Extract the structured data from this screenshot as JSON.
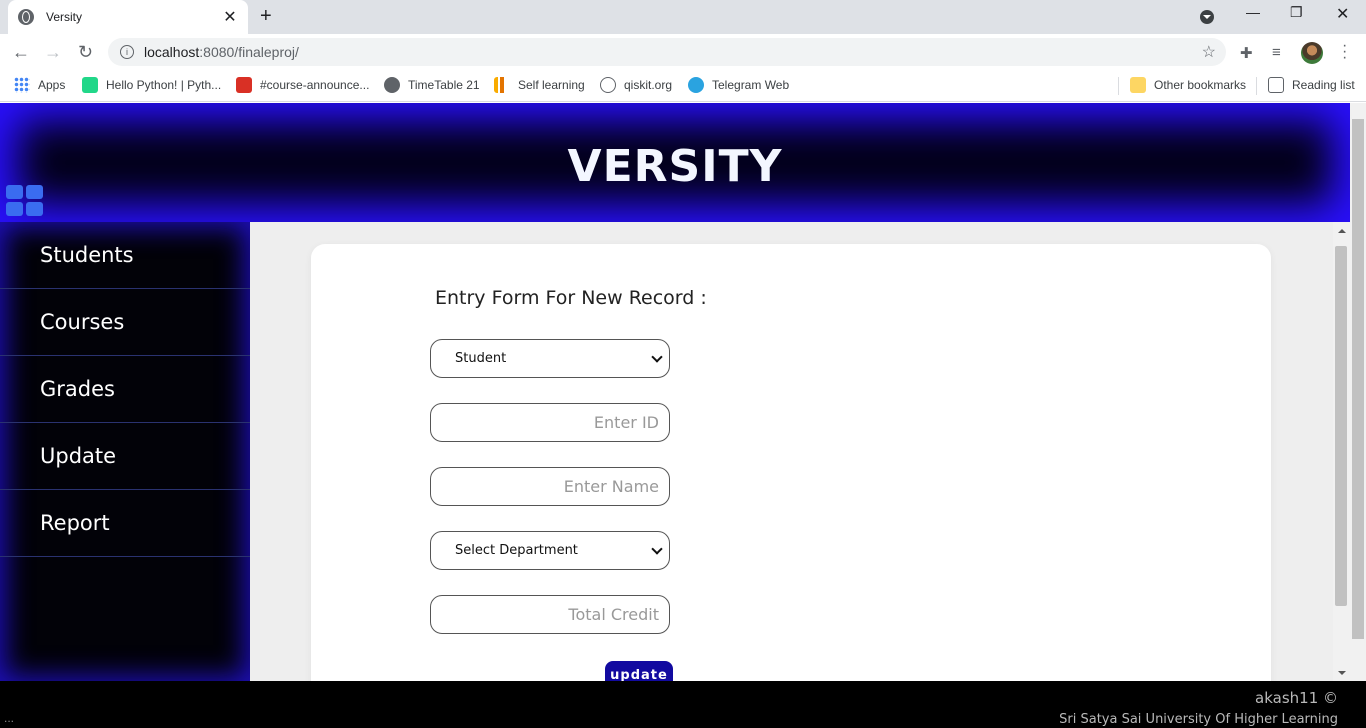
{
  "browser": {
    "tab_title": "Versity",
    "tab_close": "✕",
    "new_tab": "+",
    "url_host": "localhost",
    "url_path": ":8080/finaleproj/",
    "bookmarks": [
      {
        "label": "Apps",
        "color": "#ea4335"
      },
      {
        "label": "Hello Python! | Pyth...",
        "color": "#21d789"
      },
      {
        "label": "#course-announce...",
        "color": "#d93025"
      },
      {
        "label": "TimeTable 21",
        "color": "#5f6368"
      },
      {
        "label": "Self learning",
        "color": "#f9ab00"
      },
      {
        "label": "qiskit.org",
        "color": "#5f6368"
      },
      {
        "label": "Telegram Web",
        "color": "#2aa3e0"
      }
    ],
    "other_bookmarks": "Other bookmarks",
    "reading_list": "Reading list"
  },
  "site": {
    "brand": "VERSITY",
    "colors": {
      "header_bg": "#03001a",
      "glow": "#2a10ff",
      "button": "#120aa0",
      "grid_icon": "#3a6cf0"
    }
  },
  "sidebar": {
    "items": [
      {
        "label": "Students"
      },
      {
        "label": "Courses"
      },
      {
        "label": "Grades"
      },
      {
        "label": "Update"
      },
      {
        "label": "Report"
      }
    ]
  },
  "form": {
    "title": "Entry Form For New Record :",
    "type_select": {
      "selected": "Student"
    },
    "id_input": {
      "placeholder": "Enter ID"
    },
    "name_input": {
      "placeholder": "Enter Name"
    },
    "department_select": {
      "selected": "Select Department"
    },
    "credit_input": {
      "placeholder": "Total Credit"
    },
    "submit_label": "update"
  },
  "footer": {
    "author": "akash11 ©",
    "university": "Sri Satya Sai University Of Higher Learning",
    "dots": "..."
  }
}
